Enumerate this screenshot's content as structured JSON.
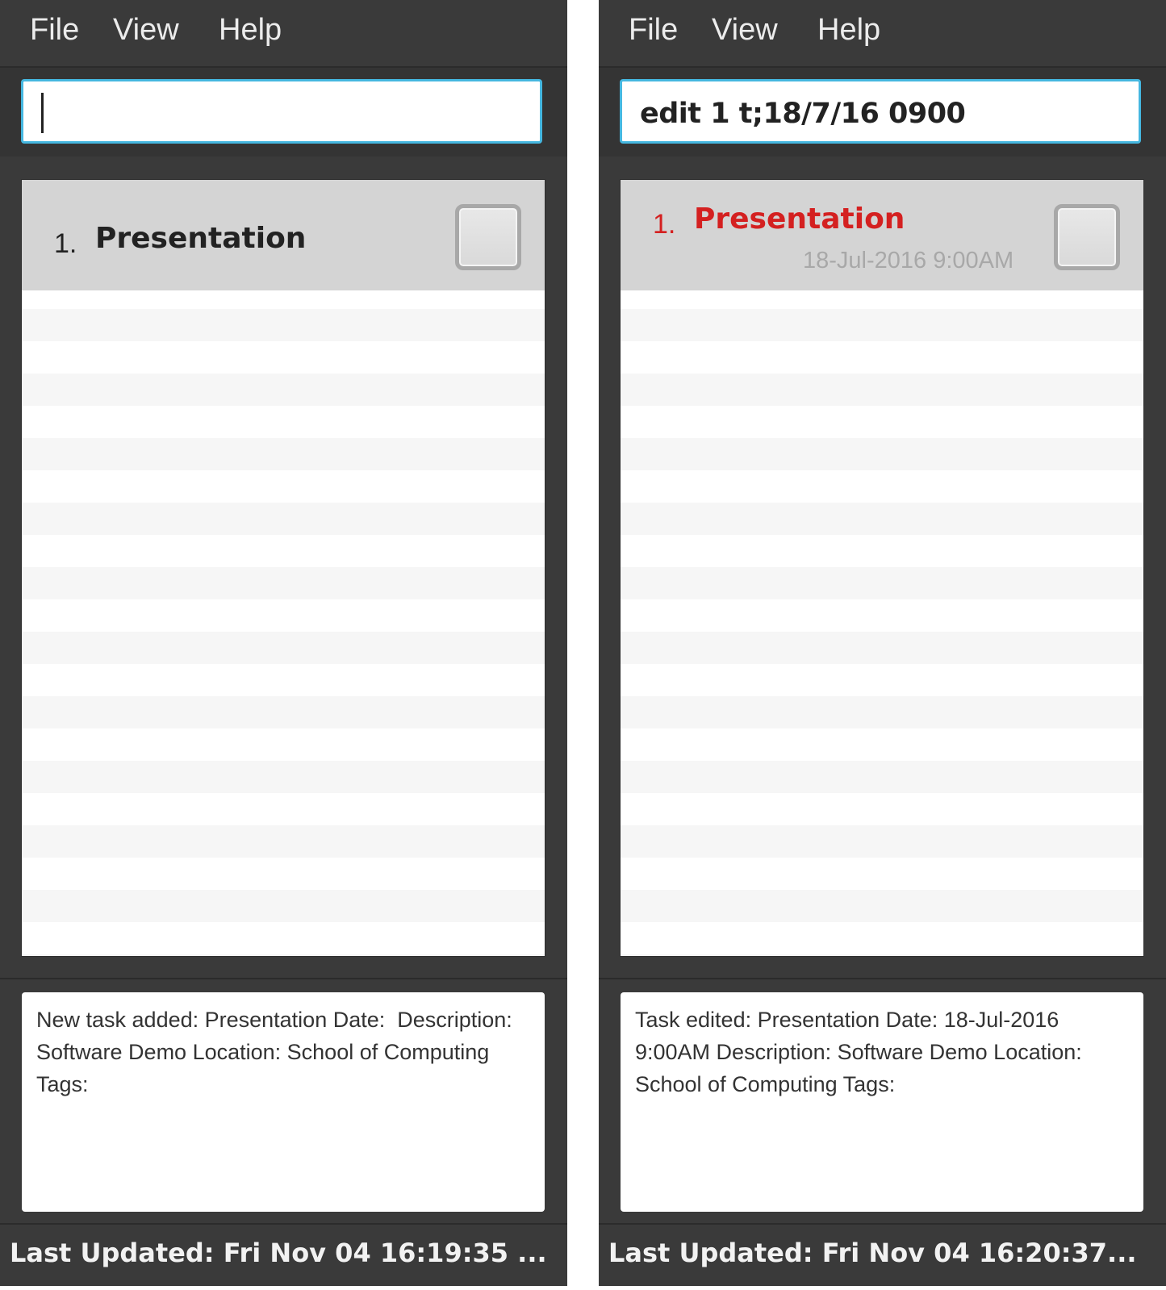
{
  "left": {
    "menu": {
      "file": "File",
      "view": "View",
      "help": "Help"
    },
    "command": {
      "value": ""
    },
    "task": {
      "index": "1.",
      "name": "Presentation"
    },
    "result": "New task added: Presentation Date:  Description: Software Demo Location: School of Computing Tags:",
    "status": "Last Updated: Fri Nov 04 16:19:35 ..."
  },
  "right": {
    "menu": {
      "file": "File",
      "view": "View",
      "help": "Help"
    },
    "command": {
      "value": "edit 1 t;18/7/16 0900"
    },
    "task": {
      "index": "1.",
      "name": "Presentation",
      "date": "18-Jul-2016 9:00AM",
      "highlight_color": "#d42020"
    },
    "result": "Task edited: Presentation Date: 18-Jul-2016 9:00AM Description: Software Demo Location: School of Computing Tags:",
    "status": "Last Updated: Fri Nov 04 16:20:37..."
  },
  "colors": {
    "input_border": "#45b7e0",
    "window_bg": "#3a3a3a"
  },
  "icons": {
    "task_checkbox": "checkbox-icon"
  }
}
